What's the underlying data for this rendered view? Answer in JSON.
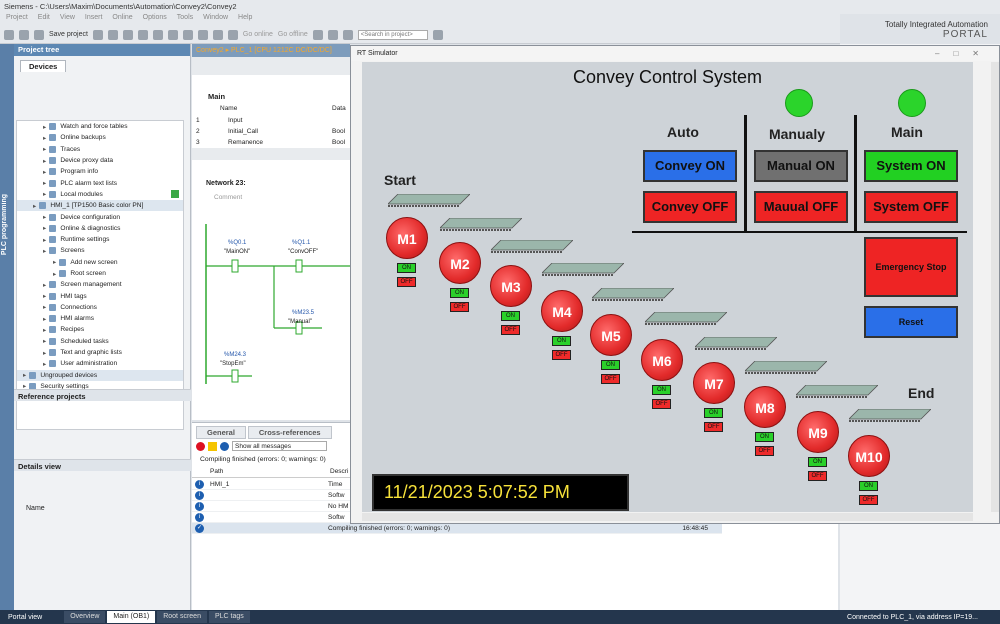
{
  "window": {
    "title": "Siemens - C:\\Users\\Maxim\\Documents\\Automation\\Convey2\\Convey2",
    "brand_line1": "Totally Integrated Automation",
    "brand_line2": "PORTAL"
  },
  "menu": [
    "Project",
    "Edit",
    "View",
    "Insert",
    "Online",
    "Options",
    "Tools",
    "Window",
    "Help"
  ],
  "toolbar": {
    "save": "Save project",
    "go_online": "Go online",
    "go_offline": "Go offline",
    "search_placeholder": "<Search in project>"
  },
  "sidestrip": "PLC programming",
  "project_tree": {
    "title": "Project tree",
    "tab": "Devices",
    "items": [
      {
        "label": "Watch and force tables",
        "indent": 2
      },
      {
        "label": "Online backups",
        "indent": 2
      },
      {
        "label": "Traces",
        "indent": 2
      },
      {
        "label": "Device proxy data",
        "indent": 2
      },
      {
        "label": "Program info",
        "indent": 2
      },
      {
        "label": "PLC alarm text lists",
        "indent": 2
      },
      {
        "label": "Local modules",
        "indent": 2
      },
      {
        "label": "HMI_1 [TP1500 Basic color PN]",
        "indent": 1,
        "hl": true
      },
      {
        "label": "Device configuration",
        "indent": 2
      },
      {
        "label": "Online & diagnostics",
        "indent": 2
      },
      {
        "label": "Runtime settings",
        "indent": 2
      },
      {
        "label": "Screens",
        "indent": 2
      },
      {
        "label": "Add new screen",
        "indent": 3
      },
      {
        "label": "Root screen",
        "indent": 3
      },
      {
        "label": "Screen management",
        "indent": 2
      },
      {
        "label": "HMI tags",
        "indent": 2
      },
      {
        "label": "Connections",
        "indent": 2
      },
      {
        "label": "HMI alarms",
        "indent": 2
      },
      {
        "label": "Recipes",
        "indent": 2
      },
      {
        "label": "Scheduled tasks",
        "indent": 2
      },
      {
        "label": "Text and graphic lists",
        "indent": 2
      },
      {
        "label": "User administration",
        "indent": 2
      },
      {
        "label": "Ungrouped devices",
        "indent": 0,
        "hl": true
      },
      {
        "label": "Security settings",
        "indent": 0
      },
      {
        "label": "Common data",
        "indent": 0
      }
    ],
    "reference_projects": "Reference projects",
    "details_view": "Details view",
    "details_col": "Name"
  },
  "editor": {
    "tab": "Convey2 ▸ PLC_1 [CPU 1212C DC/DC/DC]",
    "block": "Main",
    "col_name": "Name",
    "col_data": "Data",
    "rows": [
      {
        "n": "1",
        "name": "Input",
        "type": ""
      },
      {
        "n": "2",
        "name": "Initial_Call",
        "type": "Bool"
      },
      {
        "n": "3",
        "name": "Remanence",
        "type": "Bool"
      }
    ],
    "network": "Network 23:",
    "comment": "Comment",
    "contacts": [
      {
        "addr": "%Q0.1",
        "name": "\"MainON\""
      },
      {
        "addr": "%Q1.1",
        "name": "\"ConvOFF\""
      },
      {
        "addr": "%M23.5",
        "name": "\"Manual\""
      },
      {
        "addr": "%M24.3",
        "name": "\"StopEm\""
      }
    ]
  },
  "inspector": {
    "tabs": [
      "General",
      "Cross-references"
    ],
    "filter": "Show all messages",
    "summary": "Compiling finished (errors: 0; warnings: 0)",
    "col_path": "Path",
    "col_desc": "Descri",
    "rows": [
      {
        "path": "HMI_1",
        "desc": "Time"
      },
      {
        "path": "",
        "desc": "Softw"
      },
      {
        "path": "",
        "desc": "No HM"
      },
      {
        "path": "",
        "desc": "Softw"
      }
    ],
    "final": "Compiling finished (errors: 0; warnings: 0)",
    "final_time": "16:48:45"
  },
  "statusbar": {
    "portal": "Portal view",
    "tabs": [
      "Overview",
      "Main (OB1)",
      "Root screen",
      "PLC tags"
    ],
    "connection": "Connected to PLC_1, via address IP=19..."
  },
  "simulator": {
    "title": "RT Simulator",
    "screen_title": "Convey Control System",
    "sections": [
      "Auto",
      "Manualy",
      "Main"
    ],
    "buttons": {
      "convey_on": "Convey ON",
      "convey_off": "Convey OFF",
      "manual_on": "Manual ON",
      "manual_off": "Mauual OFF",
      "system_on": "System ON",
      "system_off": "System OFF",
      "emergency": "Emergency Stop",
      "reset": "Reset"
    },
    "start": "Start",
    "end": "End",
    "motors": [
      "M1",
      "M2",
      "M3",
      "M4",
      "M5",
      "M6",
      "M7",
      "M8",
      "M9",
      "M10"
    ],
    "on_label": "ON",
    "off_label": "OFF",
    "datetime": "11/21/2023 5:07:52 PM",
    "colors": {
      "lamp": "#2bd42b",
      "blue": "#2a6fe8",
      "red": "#ee2424",
      "green": "#22d022",
      "grey": "#707070"
    }
  }
}
